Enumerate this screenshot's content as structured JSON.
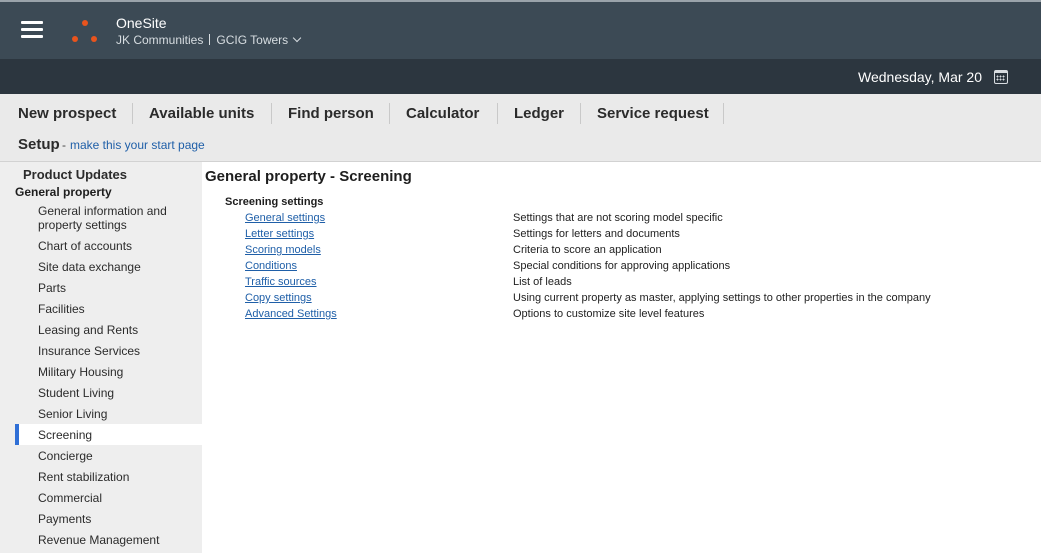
{
  "header": {
    "app_title": "OneSite",
    "company": "JK Communities",
    "site": "GCIG Towers",
    "date": "Wednesday, Mar 20"
  },
  "colors": {
    "header_bg": "#3c4a55",
    "datebar_bg": "#2c363f",
    "logo_orange": "#e9541d",
    "link_blue": "#1f5fa8",
    "active_indicator": "#2f6fd6"
  },
  "nav": {
    "items": [
      "New prospect",
      "Available units",
      "Find person",
      "Calculator",
      "Ledger",
      "Service request"
    ]
  },
  "setup": {
    "title": "Setup",
    "dash": "-",
    "start_page_link": "make this your start page"
  },
  "sidebar": {
    "updates": "Product Updates",
    "group": "General property",
    "items": [
      "General information and property settings",
      "Chart of accounts",
      "Site data exchange",
      "Parts",
      "Facilities",
      "Leasing and Rents",
      "Insurance Services",
      "Military Housing",
      "Student Living",
      "Senior Living",
      "Screening",
      "Concierge",
      "Rent stabilization",
      "Commercial",
      "Payments",
      "Revenue Management"
    ],
    "active": "Screening"
  },
  "main": {
    "title": "General property - Screening",
    "section": "Screening settings",
    "rows": [
      {
        "link": "General settings",
        "desc": "Settings that are not scoring model specific"
      },
      {
        "link": "Letter settings",
        "desc": "Settings for letters and documents"
      },
      {
        "link": "Scoring models",
        "desc": "Criteria to score an application"
      },
      {
        "link": "Conditions",
        "desc": "Special conditions for approving applications"
      },
      {
        "link": "Traffic sources",
        "desc": "List of leads"
      },
      {
        "link": "Copy settings",
        "desc": "Using current property as master, applying settings to other properties in the company"
      },
      {
        "link": "Advanced Settings",
        "desc": "Options to customize site level features"
      }
    ]
  },
  "icons": {
    "menu": "hamburger-menu-icon",
    "logo": "onesite-logo-icon",
    "calendar": "calendar-icon",
    "dropdown": "chevron-down-icon"
  }
}
